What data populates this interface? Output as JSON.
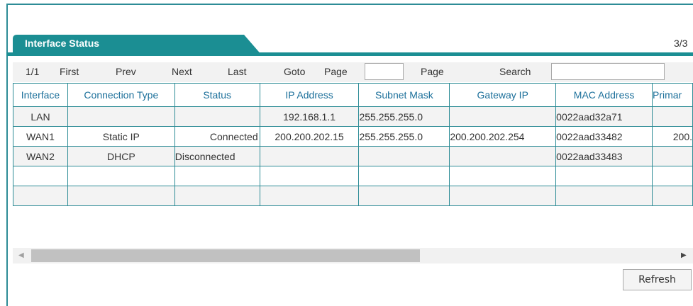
{
  "panel": {
    "title": "Interface Status",
    "page_count": "3/3"
  },
  "pager": {
    "position": "1/1",
    "first": "First",
    "prev": "Prev",
    "next": "Next",
    "last": "Last",
    "goto": "Goto",
    "page_label_before": "Page",
    "page_input_value": "",
    "page_label_after": "Page",
    "search_label": "Search",
    "search_value": ""
  },
  "table": {
    "columns": [
      "Interface",
      "Connection Type",
      "Status",
      "IP Address",
      "Subnet Mask",
      "Gateway IP",
      "MAC Address",
      "Primar"
    ],
    "rows": [
      [
        "LAN",
        "",
        "",
        "192.168.1.1",
        "255.255.255.0",
        "",
        "0022aad32a71",
        ""
      ],
      [
        "WAN1",
        "Static IP",
        "Connected",
        "200.200.202.15",
        "255.255.255.0",
        "200.200.202.254",
        "0022aad33482",
        "200."
      ],
      [
        "WAN2",
        "DHCP",
        "Disconnected",
        "",
        "",
        "",
        "0022aad33483",
        ""
      ],
      [
        "",
        "",
        "",
        "",
        "",
        "",
        "",
        ""
      ],
      [
        "",
        "",
        "",
        "",
        "",
        "",
        "",
        ""
      ]
    ]
  },
  "scrollbar": {
    "left_arrow": "◀",
    "right_arrow": "▶"
  },
  "actions": {
    "refresh": "Refresh"
  },
  "colors": {
    "accent": "#1b8e93",
    "border": "#2d8c96",
    "header_text": "#1b6f9a"
  }
}
